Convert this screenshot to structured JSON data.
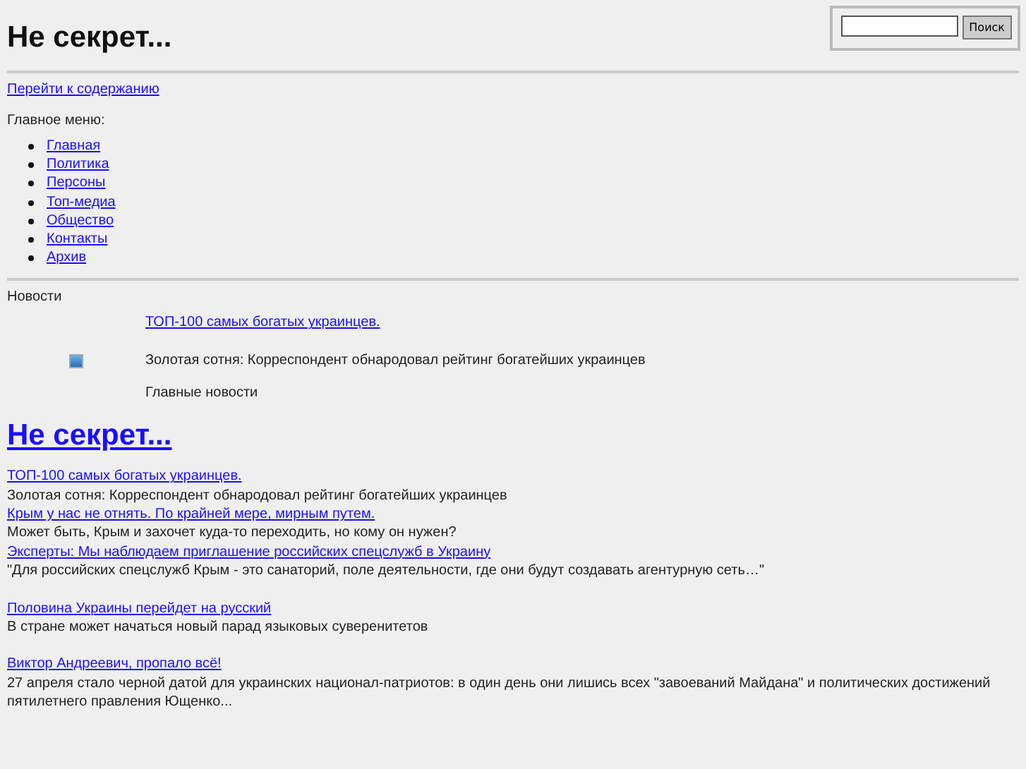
{
  "site_title": "Не секрет...",
  "search": {
    "button": "Поиск"
  },
  "skip_link": "Перейти к содержанию",
  "menu_label": "Главное меню:",
  "menu": [
    "Главная",
    "Политика",
    "Персоны",
    "Топ-медиа",
    "Общество",
    "Контакты",
    "Архив"
  ],
  "news_label": "Новости",
  "featured": {
    "link": "ТОП-100 самых богатых украинцев.",
    "summary": "Золотая сотня: Корреспондент обнародовал рейтинг богатейших украинцев",
    "caption": "Главные новости"
  },
  "home_link": "Не секрет...",
  "news_groups": [
    [
      {
        "title": "ТОП-100 самых богатых украинцев.",
        "summary": "Золотая сотня: Корреспондент обнародовал рейтинг богатейших украинцев"
      },
      {
        "title": "Крым у нас не отнять. По крайней мере, мирным путем.",
        "summary": "Может быть, Крым и захочет куда-то переходить, но кому он нужен?"
      },
      {
        "title": "Эксперты: Мы наблюдаем приглашение российских спецслужб в Украину",
        "summary": "\"Для российских спецслужб Крым - это санаторий, поле деятельности, где они будут создавать агентурную сеть…\""
      }
    ],
    [
      {
        "title": "Половина Украины перейдет на русский",
        "summary": "В стране может начаться новый парад языковых суверенитетов"
      }
    ],
    [
      {
        "title": "Виктор Андреевич, пропало всё!",
        "summary": "27 апреля стало черной датой для украинских национал-патриотов: в один день они лишись всех \"завоеваний Майдана\" и политических достижений пятилетнего правления Ющенко..."
      }
    ]
  ]
}
